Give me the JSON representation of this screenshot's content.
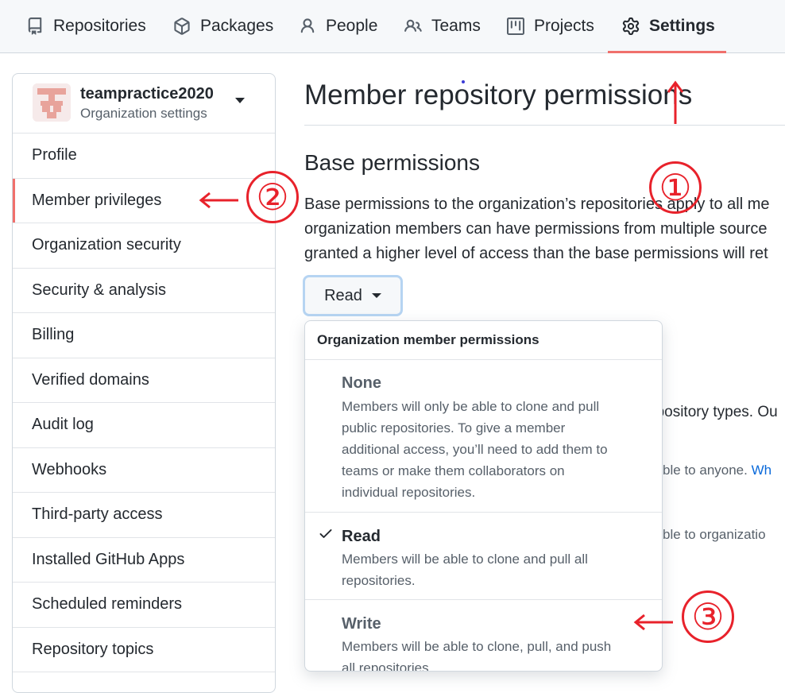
{
  "top_nav": {
    "tabs": [
      {
        "label": "Repositories",
        "icon": "repo-icon"
      },
      {
        "label": "Packages",
        "icon": "package-icon"
      },
      {
        "label": "People",
        "icon": "person-icon"
      },
      {
        "label": "Teams",
        "icon": "people-icon"
      },
      {
        "label": "Projects",
        "icon": "project-icon"
      },
      {
        "label": "Settings",
        "icon": "gear-icon",
        "active": true
      }
    ],
    "accent_color": "#f0706c"
  },
  "sidebar": {
    "org_name": "teampractice2020",
    "org_subtitle": "Organization settings",
    "items": [
      {
        "label": "Profile"
      },
      {
        "label": "Member privileges",
        "active": true
      },
      {
        "label": "Organization security"
      },
      {
        "label": "Security & analysis"
      },
      {
        "label": "Billing"
      },
      {
        "label": "Verified domains"
      },
      {
        "label": "Audit log"
      },
      {
        "label": "Webhooks"
      },
      {
        "label": "Third-party access"
      },
      {
        "label": "Installed GitHub Apps"
      },
      {
        "label": "Scheduled reminders"
      },
      {
        "label": "Repository topics"
      }
    ]
  },
  "main": {
    "page_title": "Member repository permissions",
    "section_title": "Base permissions",
    "description_lines": [
      "Base permissions to the organization’s repositories apply to all me",
      "organization members can have permissions from multiple source",
      "granted a higher level of access than the base permissions will ret"
    ],
    "base_permission_button": "Read",
    "behind_text": {
      "repo_types": "epository types. Ou",
      "visible_anyone": "isible to anyone.",
      "visible_anyone_link": "Wh",
      "visible_org": "isible to organizatio"
    }
  },
  "dropdown": {
    "header": "Organization member permissions",
    "options": [
      {
        "title": "None",
        "description": [
          "Members will only be able to clone and pull",
          "public repositories. To give a member",
          "additional access, you’ll need to add them to",
          "teams or make them collaborators on",
          "individual repositories."
        ],
        "selected": false
      },
      {
        "title": "Read",
        "description": [
          "Members will be able to clone and pull all",
          "repositories."
        ],
        "selected": true
      },
      {
        "title": "Write",
        "description": [
          "Members will be able to clone, pull, and push",
          "all repositories."
        ],
        "selected": false
      }
    ]
  },
  "annotations": {
    "marker_1": "①",
    "marker_2": "②",
    "marker_3": "③",
    "color": "#e8222b"
  }
}
